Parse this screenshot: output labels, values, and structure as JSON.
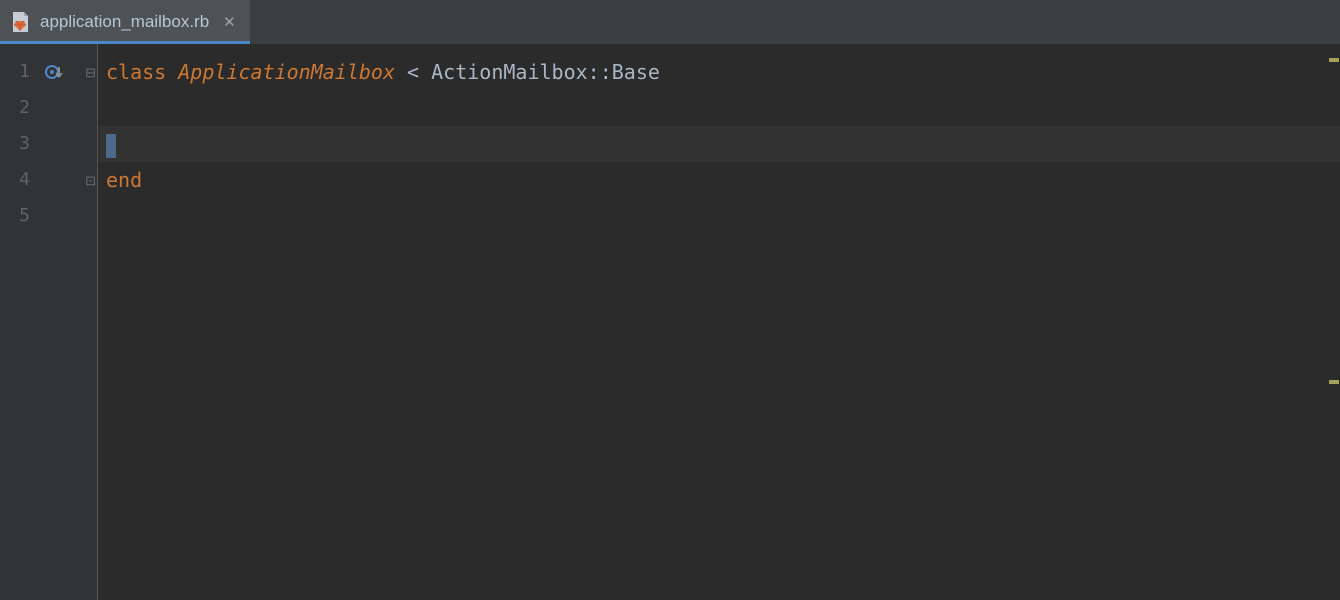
{
  "tab": {
    "filename": "application_mailbox.rb",
    "closeGlyph": "✕"
  },
  "lines": [
    "1",
    "2",
    "3",
    "4",
    "5"
  ],
  "code": {
    "line1": {
      "kw": "class ",
      "classname": "ApplicationMailbox",
      "rest": " < ActionMailbox::Base"
    },
    "line4": {
      "kw": "end"
    }
  },
  "foldGlyphs": {
    "open": "⊟",
    "close": "⊡"
  }
}
